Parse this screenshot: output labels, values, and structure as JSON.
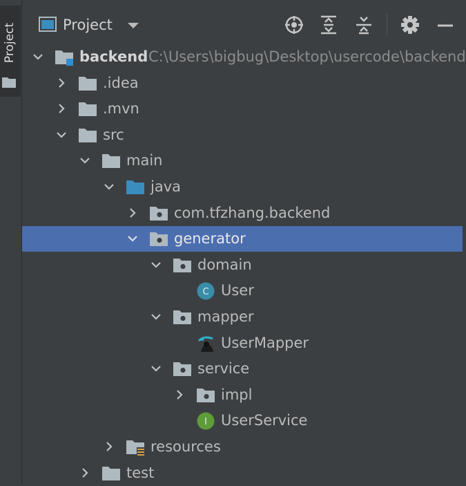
{
  "stripe": {
    "label": "Project"
  },
  "header": {
    "title": "Project"
  },
  "tree": [
    {
      "name": "backend",
      "path": "C:\\Users\\bigbug\\Desktop\\usercode\\backend",
      "expanded": true,
      "icon": "module-folder-icon"
    },
    {
      "name": ".idea",
      "expanded": false,
      "icon": "folder-icon"
    },
    {
      "name": ".mvn",
      "expanded": false,
      "icon": "folder-icon"
    },
    {
      "name": "src",
      "expanded": true,
      "icon": "folder-icon"
    },
    {
      "name": "main",
      "expanded": true,
      "icon": "folder-icon"
    },
    {
      "name": "java",
      "expanded": true,
      "icon": "source-root-folder-icon"
    },
    {
      "name": "com.tfzhang.backend",
      "expanded": false,
      "icon": "package-icon"
    },
    {
      "name": "generator",
      "expanded": true,
      "icon": "package-icon",
      "selected": true
    },
    {
      "name": "domain",
      "expanded": true,
      "icon": "package-icon"
    },
    {
      "name": "User",
      "icon": "class-icon",
      "badge": "C"
    },
    {
      "name": "mapper",
      "expanded": true,
      "icon": "package-icon"
    },
    {
      "name": "UserMapper",
      "icon": "mybatis-mapper-icon"
    },
    {
      "name": "service",
      "expanded": true,
      "icon": "package-icon"
    },
    {
      "name": "impl",
      "expanded": false,
      "icon": "package-icon"
    },
    {
      "name": "UserService",
      "icon": "interface-icon",
      "badge": "I"
    },
    {
      "name": "resources",
      "expanded": false,
      "icon": "resources-folder-icon"
    },
    {
      "name": "test",
      "expanded": false,
      "icon": "folder-icon"
    }
  ],
  "colors": {
    "background": "#3c3f41",
    "selection": "#4b6eaf",
    "folder": "#aeb9c0",
    "source_root": "#3a8dbf",
    "class_badge": "#3a8da8",
    "interface_badge": "#5e9c39"
  }
}
